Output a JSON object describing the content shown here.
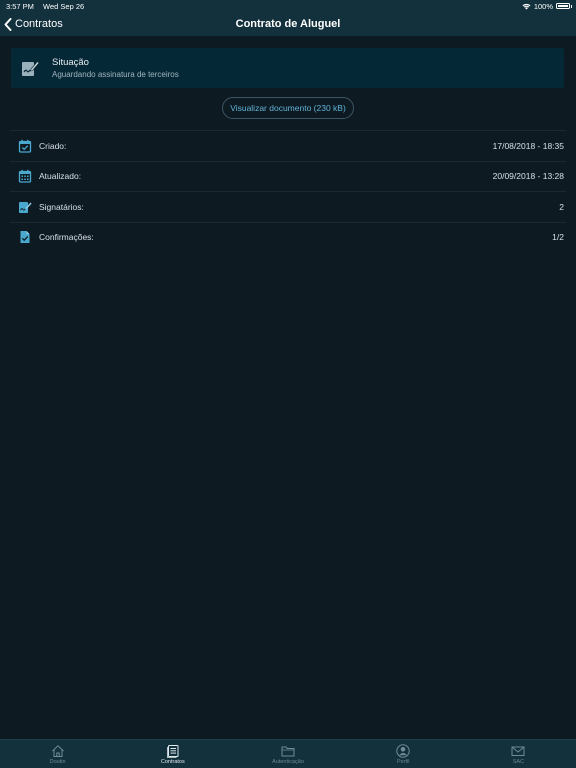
{
  "status_bar": {
    "time": "3:57 PM",
    "date": "Wed Sep 26",
    "battery": "100%"
  },
  "nav": {
    "back_label": "Contratos",
    "title": "Contrato de Aluguel"
  },
  "situacao": {
    "title": "Situação",
    "subtitle": "Aguardando assinatura de terceiros"
  },
  "document_button": "Visualizar documento (230 kB)",
  "info_rows": [
    {
      "label": "Criado:",
      "value": "17/08/2018 - 18:35",
      "icon": "calendar-check-icon"
    },
    {
      "label": "Atualizado:",
      "value": "20/09/2018 - 13:28",
      "icon": "calendar-icon"
    },
    {
      "label": "Signatários:",
      "value": "2",
      "icon": "signature-icon"
    },
    {
      "label": "Confirmações:",
      "value": "1/2",
      "icon": "document-check-icon"
    }
  ],
  "tabs": [
    {
      "label": "Doutin",
      "icon": "home-icon",
      "active": false
    },
    {
      "label": "Contratos",
      "icon": "contracts-icon",
      "active": true
    },
    {
      "label": "Autenticação",
      "icon": "folder-icon",
      "active": false
    },
    {
      "label": "Perfil",
      "icon": "profile-icon",
      "active": false
    },
    {
      "label": "SAC",
      "icon": "mail-icon",
      "active": false
    }
  ],
  "colors": {
    "background": "#0e1a22",
    "bar": "#13303d",
    "card": "#052836",
    "accent": "#5fb3d6",
    "icon": "#4aa8cf"
  }
}
